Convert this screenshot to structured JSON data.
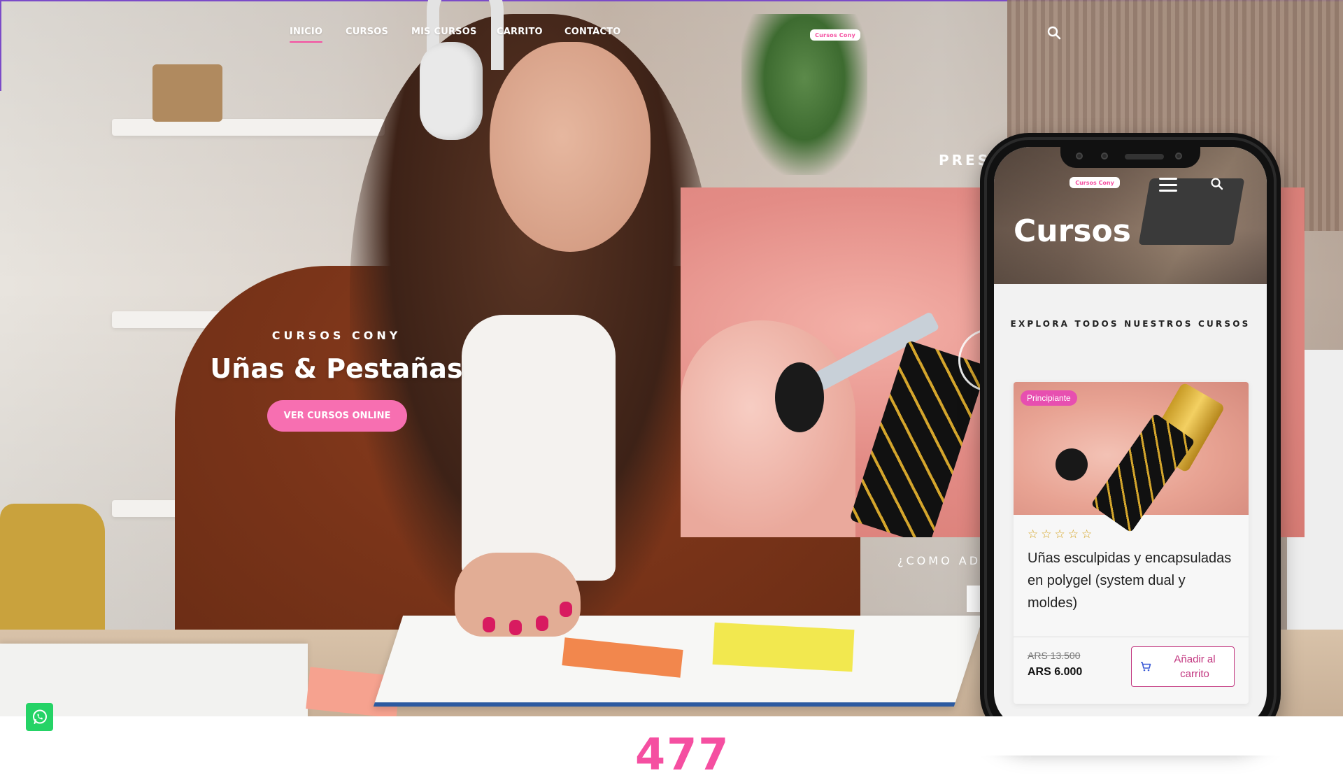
{
  "nav": {
    "items": [
      {
        "label": "INICIO",
        "active": true
      },
      {
        "label": "CURSOS",
        "active": false
      },
      {
        "label": "MIS CURSOS",
        "active": false
      },
      {
        "label": "CARRITO",
        "active": false
      },
      {
        "label": "CONTACTO",
        "active": false
      }
    ],
    "logo_text": "Cursos Cony",
    "search_icon": "search-icon"
  },
  "hero": {
    "eyebrow": "CURSOS CONY",
    "title": "Uñas & Pestañas",
    "button_label": "VER CURSOS ONLINE"
  },
  "section": {
    "partial_heading": "PRES",
    "partial_question": "¿COMO AD",
    "play_icon": "play-icon"
  },
  "phone": {
    "logo_text": "Cursos Cony",
    "menu_icon": "hamburger-icon",
    "search_icon": "search-icon",
    "page_title": "Cursos",
    "section_label": "EXPLORA TODOS NUESTROS CURSOS",
    "course": {
      "badge": "Principiante",
      "rating": 0,
      "stars": "☆☆☆☆☆",
      "title": "Uñas esculpidas y encapsuladas en polygel (system dual y moldes)",
      "old_price": "ARS 13.500",
      "new_price": "ARS 6.000",
      "add_label": "Añadir al carrito",
      "cart_icon": "cart-icon"
    }
  },
  "footer": {
    "counter": "477",
    "whatsapp_icon": "whatsapp-icon"
  },
  "colors": {
    "accent": "#f54fa1",
    "button_pink": "#f76fb1",
    "badge_pink": "#e74fb0",
    "add_button_border": "#c2357f",
    "whatsapp_green": "#25d366",
    "top_border_purple": "#7b4bc8"
  }
}
